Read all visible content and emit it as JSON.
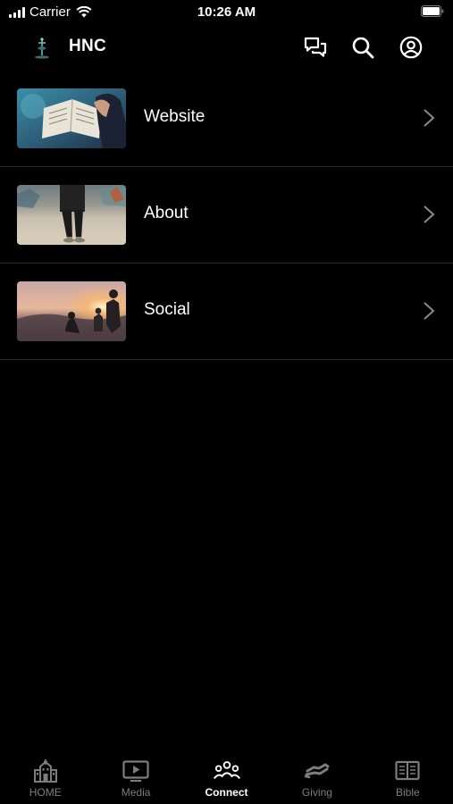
{
  "status_bar": {
    "carrier": "Carrier",
    "time": "10:26 AM"
  },
  "header": {
    "title": "HNC",
    "icons": [
      "chat-icon",
      "search-icon",
      "account-icon"
    ]
  },
  "menu": {
    "items": [
      {
        "label": "Website",
        "thumbnail": "bible-reading-photo"
      },
      {
        "label": "About",
        "thumbnail": "person-standing-photo"
      },
      {
        "label": "Social",
        "thumbnail": "sunset-people-photo"
      }
    ]
  },
  "tab_bar": {
    "active": "Connect",
    "tabs": [
      {
        "label": "HOME",
        "icon": "church-building-icon"
      },
      {
        "label": "Media",
        "icon": "video-play-icon"
      },
      {
        "label": "Connect",
        "icon": "people-group-icon"
      },
      {
        "label": "Giving",
        "icon": "giving-hand-icon"
      },
      {
        "label": "Bible",
        "icon": "open-book-icon"
      }
    ]
  },
  "colors": {
    "background": "#000000",
    "text": "#ffffff",
    "inactive_tab": "#7d7d7d",
    "divider": "#2a2a2a"
  }
}
